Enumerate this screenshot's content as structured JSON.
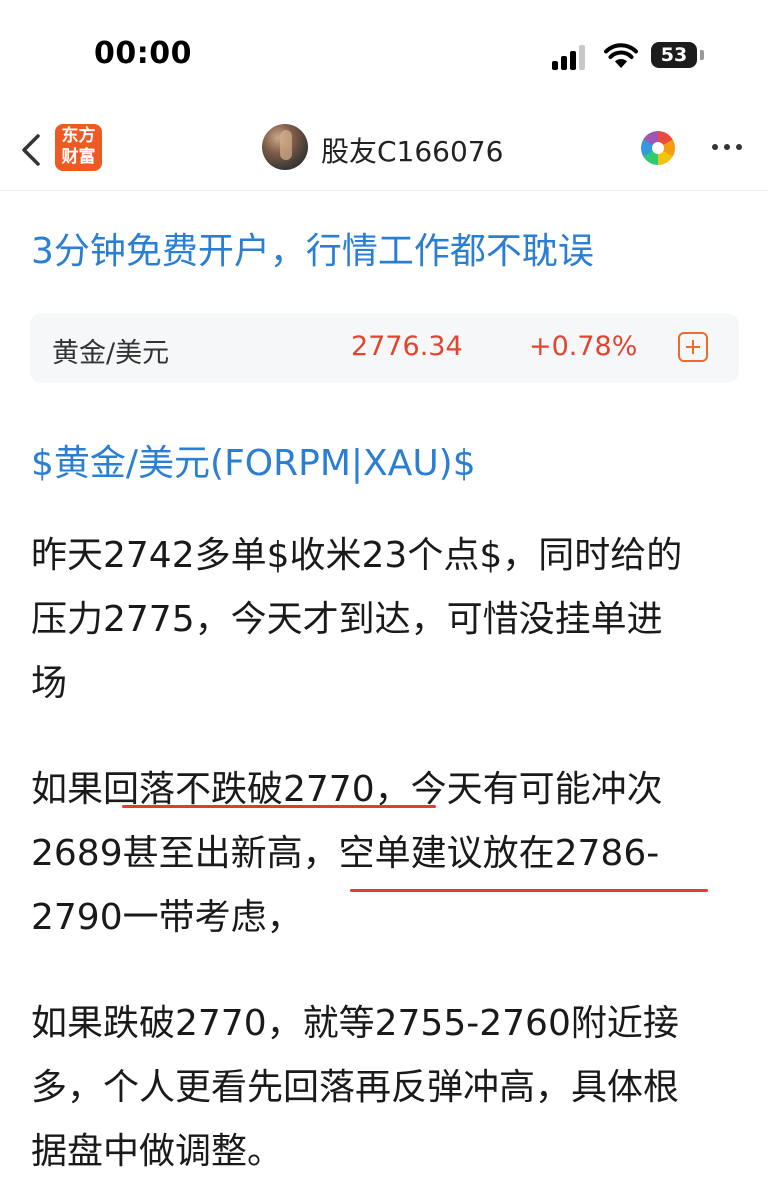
{
  "status_bar": {
    "time": "00:00",
    "battery": "53"
  },
  "nav": {
    "logo_line1": "东方",
    "logo_line2": "财富",
    "username": "股友C166076"
  },
  "promo_text": "3分钟免费开户，行情工作都不耽误",
  "stock": {
    "name": "黄金/美元",
    "price": "2776.34",
    "change": "+0.78%"
  },
  "post": {
    "stock_tag": "$黄金/美元(FORPM|XAU)$",
    "lines": [
      "昨天2742多单$收米23个点$，同时给的",
      "压力2775，今天才到达，可惜没挂单进",
      "场",
      "如果回落不跌破2770，今天有可能冲次",
      "2689甚至出新高，空单建议放在2786-",
      "2790一带考虑，",
      "如果跌破2770，就等2755-2760附近接",
      "多，个人更看先回落再反弹冲高，具体根",
      "据盘中做调整。"
    ]
  },
  "colors": {
    "link_blue": "#2a7fd4",
    "price_red": "#e2452f",
    "underline_red": "#e23c2c",
    "brand_orange": "#ee5a24"
  }
}
